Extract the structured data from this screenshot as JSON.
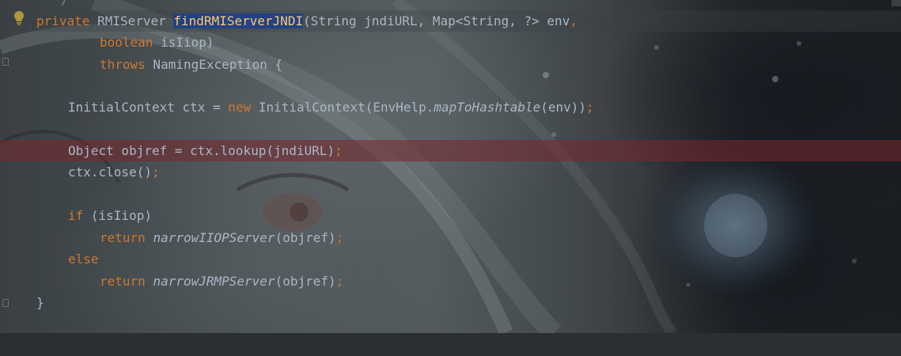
{
  "editor": {
    "language": "Java",
    "top_fragment": "**/",
    "lines": {
      "l1": {
        "kw1": "private",
        "t1": " RMIServer ",
        "fn": "findRMIServerJNDI",
        "t2": "(String jndiURL, Map<String, ?> env",
        "p1": ",",
        "t3": ""
      },
      "l2": {
        "kw1": "boolean",
        "t1": " isIiop)"
      },
      "l3": {
        "kw1": "throws",
        "t1": " NamingException {"
      },
      "l4": {
        "t1": "InitialContext ctx = ",
        "kw1": "new",
        "t2": " InitialContext(EnvHelp.",
        "it1": "mapToHashtable",
        "t3": "(env))",
        "p1": ";"
      },
      "l5": {
        "t1": "Object objref = ctx.lookup(jndiURL)",
        "p1": ";"
      },
      "l6": {
        "t1": "ctx.close()",
        "p1": ";"
      },
      "l7": {
        "kw1": "if",
        "t1": " (isIiop)"
      },
      "l8": {
        "kw1": "return",
        "t1": " ",
        "it1": "narrowIIOPServer",
        "t2": "(objref)",
        "p1": ";"
      },
      "l9": {
        "kw1": "else"
      },
      "l10": {
        "kw1": "return",
        "t1": " ",
        "it1": "narrowJRMPServer",
        "t2": "(objref)",
        "p1": ";"
      },
      "l11": {
        "t1": "}"
      }
    }
  },
  "icons": {
    "intention_bulb": "lightbulb-icon",
    "fold_marker": "fold-marker-icon"
  },
  "colors": {
    "keyword": "#cc7832",
    "identifier": "#a9b7c6",
    "function_declaration": "#ffc66d",
    "selection": "#214283",
    "breakpoint_line": "#78282c",
    "comment": "#629755"
  }
}
